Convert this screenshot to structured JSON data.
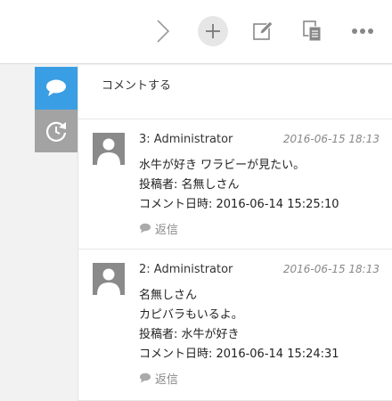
{
  "toolbar": {
    "icons": [
      "chevron-right-icon",
      "plus-icon",
      "edit-icon",
      "copy-icon",
      "more-icon"
    ]
  },
  "sidebar": {
    "tabs": [
      {
        "icon": "comment-icon",
        "active": true
      },
      {
        "icon": "history-icon",
        "active": false
      }
    ]
  },
  "comment_input": {
    "placeholder": "コメントする"
  },
  "comments": [
    {
      "author": "3: Administrator",
      "date": "2016-06-15 18:13",
      "lines": [
        "水牛が好き ワラビーが見たい。",
        "投稿者: 名無しさん",
        "コメント日時: 2016-06-14 15:25:10"
      ],
      "reply_label": "返信"
    },
    {
      "author": "2: Administrator",
      "date": "2016-06-15 18:13",
      "lines": [
        "名無しさん",
        "カピバラもいるよ。",
        "投稿者: 水牛が好き",
        "コメント日時: 2016-06-14 15:24:31"
      ],
      "reply_label": "返信"
    }
  ],
  "colors": {
    "accent": "#3a9ee4",
    "inactive_tab": "#a3a3a3",
    "avatar": "#8a8a8a"
  }
}
